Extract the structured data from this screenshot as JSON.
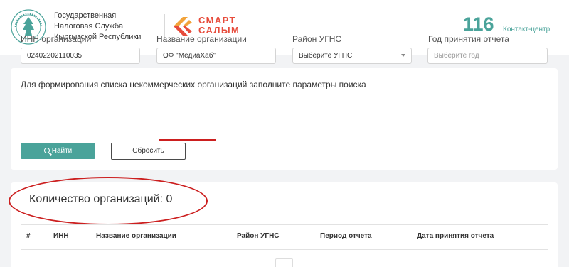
{
  "header": {
    "agency_lines": [
      "Государственная",
      "Налоговая Служба",
      "Кыргызской Республики"
    ],
    "brand_top": "СМАРТ",
    "brand_bottom": "САЛЫМ",
    "phone": "116",
    "phone_label": "Контакт-центр",
    "emblem_icon": "tax-service-emblem-icon",
    "brand_icon": "smart-salym-logo-icon"
  },
  "search": {
    "title": "Для формирования списка некоммерческих организаций заполните параметры поиска",
    "fields": {
      "inn": {
        "label": "ИНН организации",
        "value": "02402202110035"
      },
      "name": {
        "label": "Название организации",
        "value": "ОФ \"МедиаХаб\""
      },
      "district": {
        "label": "Район УГНС",
        "value": "Выберите УГНС"
      },
      "year": {
        "label": "Год принятия отчета",
        "placeholder": "Выберите год"
      }
    },
    "search_button": "Найти",
    "reset_button": "Сбросить"
  },
  "results": {
    "count_text": "Количество организаций: 0",
    "columns": [
      "#",
      "ИНН",
      "Название организации",
      "Район УГНС",
      "Период отчета",
      "Дата принятия отчета"
    ]
  },
  "colors": {
    "accent": "#4aa39a",
    "brand_red": "#e74c3c",
    "annotation_red": "#cc1f1f"
  }
}
